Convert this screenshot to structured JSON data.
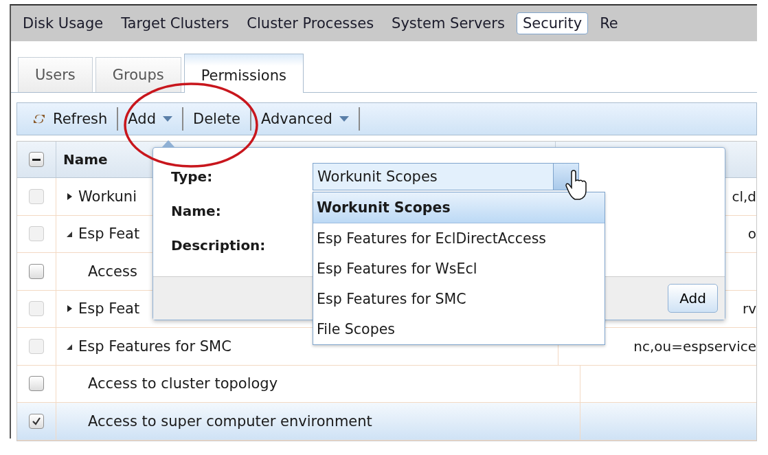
{
  "nav": {
    "items": [
      {
        "label": "Disk Usage",
        "selected": false
      },
      {
        "label": "Target Clusters",
        "selected": false
      },
      {
        "label": "Cluster Processes",
        "selected": false
      },
      {
        "label": "System Servers",
        "selected": false
      },
      {
        "label": "Security",
        "selected": true
      },
      {
        "label": "Re",
        "selected": false
      }
    ]
  },
  "tabs": [
    {
      "label": "Users",
      "selected": false
    },
    {
      "label": "Groups",
      "selected": false
    },
    {
      "label": "Permissions",
      "selected": true
    }
  ],
  "toolbar": [
    {
      "kind": "icon-button",
      "label": "Refresh"
    },
    {
      "kind": "menu",
      "label": "Add"
    },
    {
      "kind": "button",
      "label": "Delete"
    },
    {
      "kind": "menu",
      "label": "Advanced"
    }
  ],
  "grid": {
    "header_checkbox": {
      "indeterminate": true
    },
    "columns": [
      "Name"
    ],
    "rows": [
      {
        "name": "Workuni",
        "column_2": "cl,d",
        "checked": false,
        "disabled": true,
        "selected": false,
        "expanded": false
      },
      {
        "name": "Esp Feat",
        "column_2": "o",
        "checked": false,
        "disabled": true,
        "selected": false,
        "expanded": true,
        "children": [
          {
            "name": "Access",
            "checked": false,
            "disabled": false,
            "selected": false
          }
        ]
      },
      {
        "name": "Esp Feat",
        "column_2": "rv",
        "checked": false,
        "disabled": true,
        "selected": false,
        "expanded": false
      },
      {
        "name": "Esp Features for SMC",
        "column_2": "nc,ou=espservice",
        "checked": false,
        "disabled": true,
        "selected": false,
        "expanded": true,
        "children": [
          {
            "name": "Access to cluster topology",
            "checked": false,
            "disabled": false,
            "selected": false
          },
          {
            "name": "Access to super computer environment",
            "checked": true,
            "disabled": false,
            "selected": true
          }
        ]
      }
    ]
  },
  "dialog": {
    "labels": [
      "Type:",
      "Name:",
      "Description:"
    ],
    "type_select": {
      "value": "Workunit Scopes",
      "expanded": true,
      "options": [
        {
          "label": "Workunit Scopes",
          "selected": true
        },
        {
          "label": "Esp Features for EclDirectAccess",
          "selected": false
        },
        {
          "label": "Esp Features for WsEcl",
          "selected": false
        },
        {
          "label": "Esp Features for SMC",
          "selected": false
        },
        {
          "label": "File Scopes",
          "selected": false
        }
      ]
    },
    "button": "Add"
  }
}
